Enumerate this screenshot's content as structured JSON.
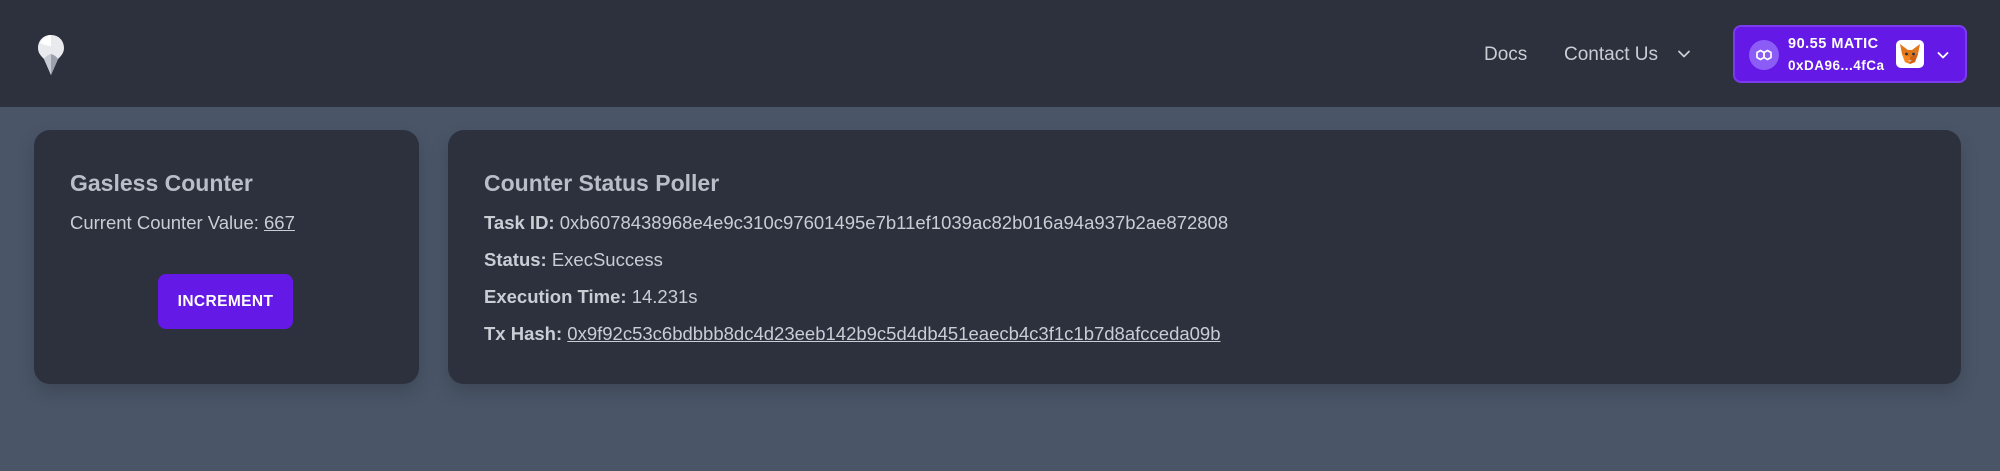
{
  "header": {
    "logo_icon": "gelato-drop-icon",
    "nav": {
      "docs_label": "Docs",
      "contact_label": "Contact Us",
      "contact_icon": "chevron-down-icon"
    },
    "wallet": {
      "network_icon": "polygon-icon",
      "balance": "90.55 MATIC",
      "address": "0xDA96...4fCa",
      "wallet_icon": "metamask-fox-icon",
      "dropdown_icon": "chevron-down-icon"
    }
  },
  "counter_card": {
    "title": "Gasless Counter",
    "value_label": "Current Counter Value: ",
    "value": "667",
    "button_label": "INCREMENT"
  },
  "poller_card": {
    "title": "Counter Status Poller",
    "task_id_label": "Task ID:",
    "task_id": "0xb6078438968e4e9c310c97601495e7b11ef1039ac82b016a94a937b2ae872808",
    "status_label": "Status:",
    "status": "ExecSuccess",
    "exec_time_label": "Execution Time:",
    "exec_time": "14.231s",
    "tx_hash_label": "Tx Hash:",
    "tx_hash": "0x9f92c53c6bdbbb8dc4d23eeb142b9c5d4db451eaecb4c3f1c1b7d8afcceda09b"
  },
  "colors": {
    "accent": "#6419e6",
    "page_bg": "#4a5668",
    "card_bg": "#2c313d",
    "header_bg": "#2c313d"
  }
}
